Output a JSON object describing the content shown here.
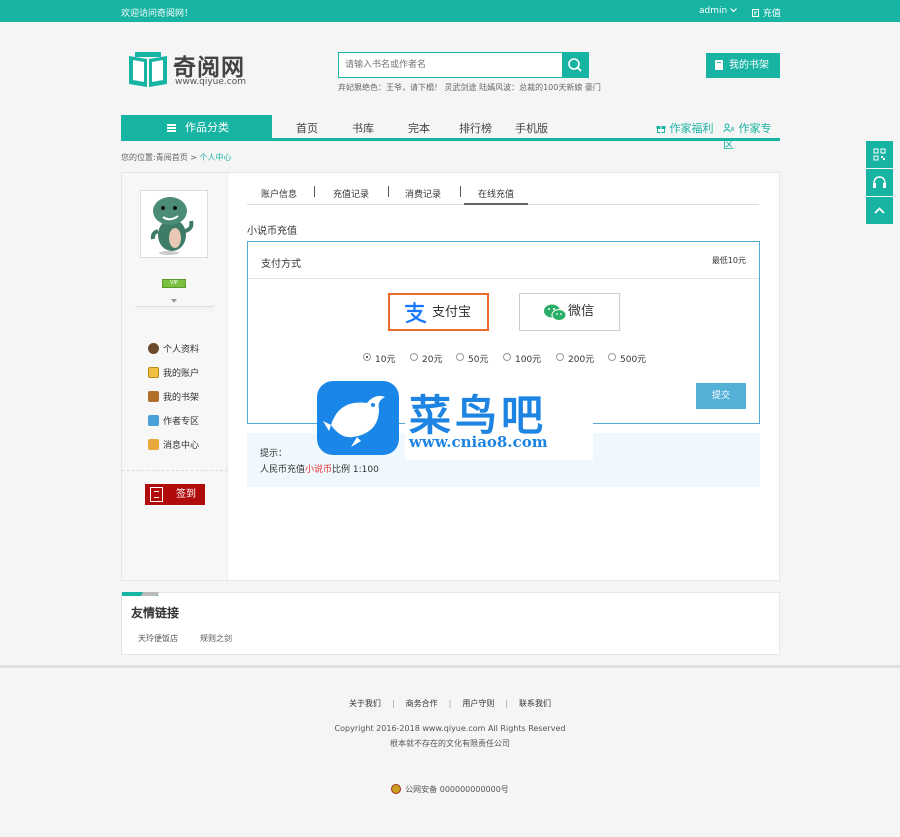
{
  "topbar": {
    "welcome": "欢迎访问奇阅网！",
    "user": "admin",
    "recharge": "充值"
  },
  "logo": {
    "name": "奇阅网",
    "domain": "www.qiyue.com"
  },
  "search": {
    "placeholder": "请输入书名或作者名",
    "hot": "弃妃狠绝色：王爷，请下榻！ 灵武剑途 陆嫣风波：总裁的100天新娘 豪门"
  },
  "bookshelf": {
    "label": "我的书架"
  },
  "nav": {
    "category": "作品分类",
    "links": [
      "首页",
      "书库",
      "完本",
      "排行榜",
      "手机版"
    ],
    "author_welfare": "作家福利",
    "author_zone": "作家专区"
  },
  "breadcrumb": {
    "prefix": "您的位置:",
    "home": "青阅首页",
    "sep": ">",
    "current": "个人中心"
  },
  "sidebar": {
    "vip_badge": "VIP",
    "menu": [
      "个人资料",
      "我的账户",
      "我的书架",
      "作者专区",
      "消息中心"
    ],
    "sign": "签到"
  },
  "tabs": [
    "账户信息",
    "充值记录",
    "消费记录",
    "在线充值"
  ],
  "active_tab": "在线充值",
  "recharge": {
    "title": "小说币充值",
    "pay_method": "支付方式",
    "min_note": "最低10元",
    "methods": [
      "支付宝",
      "微信"
    ],
    "selected_method": "支付宝",
    "amounts": [
      "10元",
      "20元",
      "50元",
      "100元",
      "200元",
      "500元"
    ],
    "selected_amount": "10元",
    "submit": "提交"
  },
  "tips": {
    "label": "提示：",
    "prefix": "人民币充值",
    "highlight": "小说币",
    "suffix": "比例 1:100"
  },
  "watermark": {
    "name": "菜鸟吧",
    "url": "www.cniao8.com"
  },
  "friends": {
    "title": "友情链接",
    "links": [
      "天玲便饭店",
      "规则之剑"
    ]
  },
  "footer": {
    "links": [
      "关于我们",
      "商务合作",
      "用户守则",
      "联系我们"
    ],
    "copyright": "Copyright 2016-2018 www.qiyue.com All Rights Reserved",
    "company": "根本就不存在的文化有限责任公司",
    "beian": "公网安备 000000000000号"
  },
  "colors": {
    "accent": "#17b3a3",
    "pay_border": "#55a9d6",
    "submit": "#55b0d8",
    "sign": "#b00c0c",
    "alipay": "#1677ff",
    "wechat": "#2aae67"
  },
  "icons": [
    "user-caret-icon",
    "recharge-icon",
    "search-icon",
    "book-icon",
    "menu-icon",
    "gift-icon",
    "users-icon",
    "qrcode-icon",
    "headset-icon",
    "chevron-up-icon"
  ]
}
